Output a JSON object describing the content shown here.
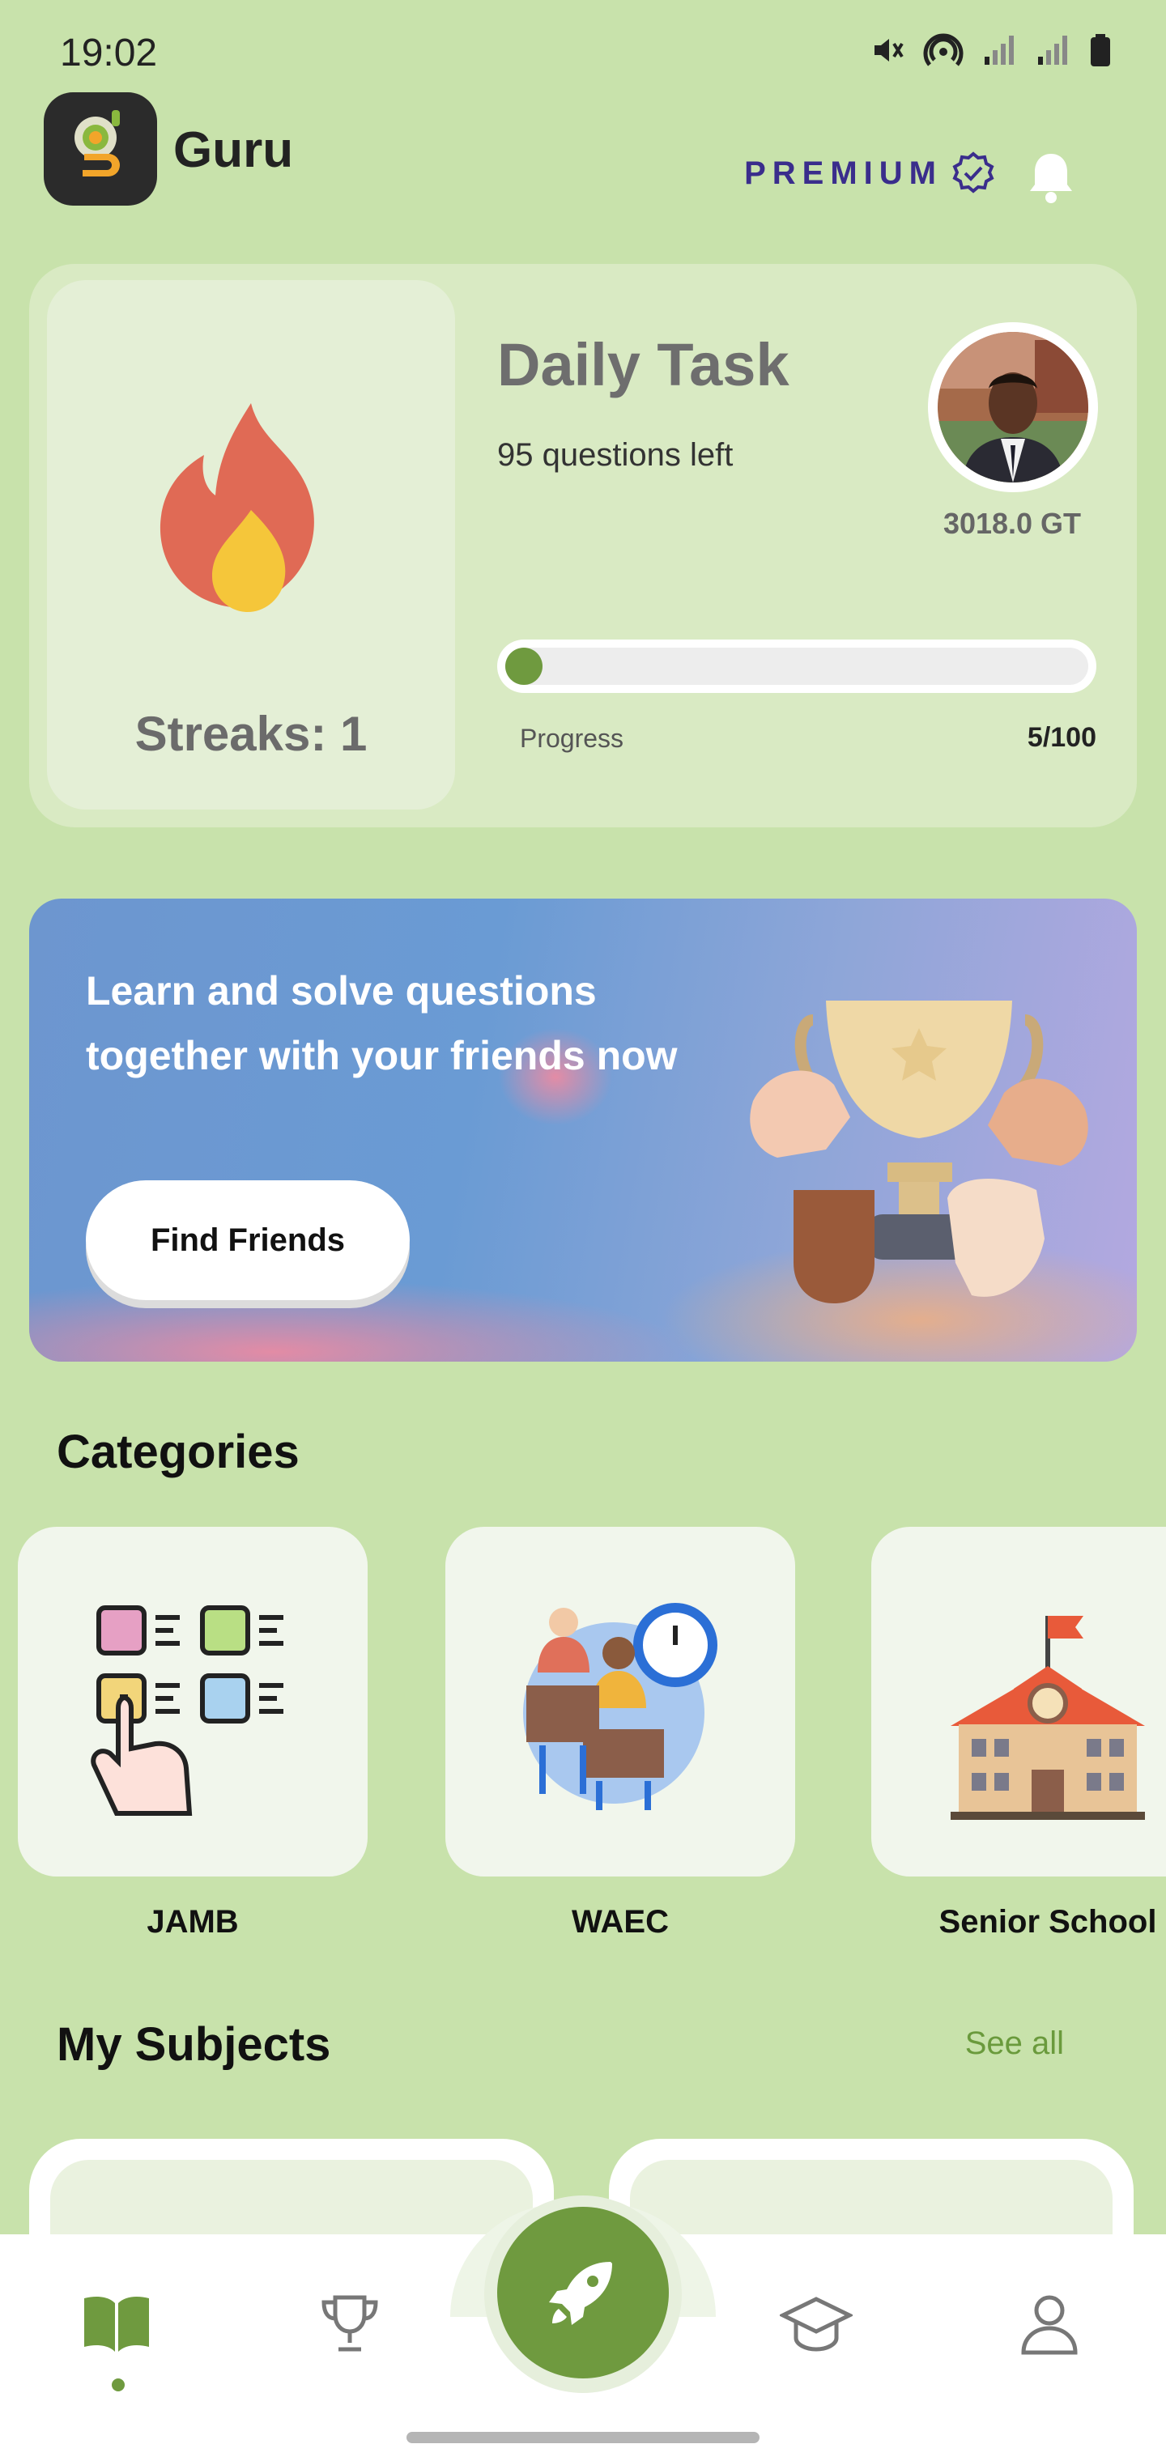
{
  "status_bar": {
    "time": "19:02",
    "icons": [
      "mute-icon",
      "hotspot-icon",
      "signal-icon",
      "signal-icon",
      "battery-icon"
    ]
  },
  "header": {
    "app_name": "Guru",
    "premium_label": "PREMIUM",
    "icons": [
      "app-logo",
      "verified-badge-icon",
      "bell-icon"
    ]
  },
  "daily_task": {
    "streak_label": "Streaks: 1",
    "title": "Daily Task",
    "questions_left": "95 questions left",
    "gt_balance": "3018.0 GT",
    "progress_label": "Progress",
    "progress_count": "5/100",
    "progress_fraction": 0.05
  },
  "banner": {
    "text": "Learn and solve questions together with your friends now",
    "button_label": "Find Friends"
  },
  "categories": {
    "title": "Categories",
    "items": [
      {
        "label": "JAMB"
      },
      {
        "label": "WAEC"
      },
      {
        "label": "Senior School"
      }
    ]
  },
  "subjects": {
    "title": "My Subjects",
    "see_all": "See all"
  },
  "bottom_nav": {
    "items": [
      "book-icon",
      "trophy-icon",
      "rocket-icon",
      "graduation-cap-icon",
      "profile-icon"
    ],
    "active": "book-icon"
  },
  "colors": {
    "background": "#c8e2ab",
    "accent": "#6f9a3f",
    "premium": "#3a2d8c"
  }
}
